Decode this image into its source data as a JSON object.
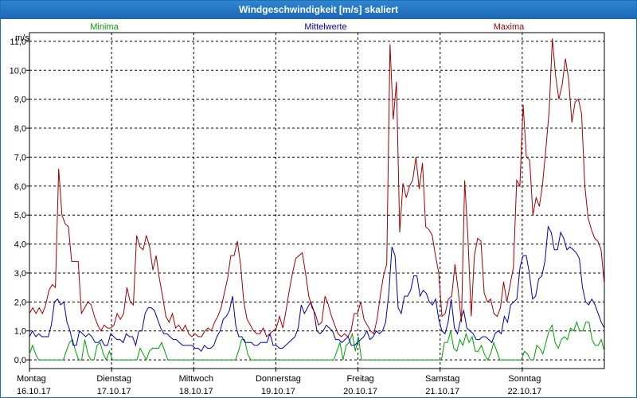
{
  "chart_data": {
    "type": "line",
    "title": "Windgeschwindigkeit [m/s] skaliert",
    "ylabel": "m/s",
    "ylim": [
      -0.3,
      11.3
    ],
    "yticks": [
      "0,0",
      "1,0",
      "2,0",
      "3,0",
      "4,0",
      "5,0",
      "6,0",
      "7,0",
      "8,0",
      "9,0",
      "10,0",
      "11,0"
    ],
    "ytick_values": [
      0,
      1,
      2,
      3,
      4,
      5,
      6,
      7,
      8,
      9,
      10,
      11
    ],
    "xlim": [
      0,
      7
    ],
    "xticks": [
      {
        "day": "Montag",
        "date": "16.10.17"
      },
      {
        "day": "Dienstag",
        "date": "17.10.17"
      },
      {
        "day": "Mittwoch",
        "date": "18.10.17"
      },
      {
        "day": "Donnerstag",
        "date": "19.10.17"
      },
      {
        "day": "Freitag",
        "date": "20.10.17"
      },
      {
        "day": "Samstag",
        "date": "21.10.17"
      },
      {
        "day": "Sonntag",
        "date": "22.10.17"
      }
    ],
    "grid": true,
    "legend_position": "top",
    "series": [
      {
        "name": "Minima",
        "color": "#00a000",
        "values": [
          0.2,
          0.5,
          0.2,
          0.0,
          0.0,
          0.0,
          0.0,
          0.0,
          0.0,
          0.0,
          0.0,
          0.0,
          0.3,
          0.6,
          0.7,
          0.3,
          0.0,
          0.0,
          0.7,
          0.2,
          0.0,
          0.0,
          0.5,
          0.6,
          0.2,
          0.0,
          0.3,
          0.0,
          0.0,
          0.0,
          0.0,
          0.0,
          0.0,
          0.0,
          0.0,
          0.0,
          0.4,
          0.2,
          0.0,
          0.3,
          0.4,
          0.4,
          0.4,
          0.6,
          0.3,
          0.0,
          0.0,
          0.0,
          0.0,
          0.0,
          0.0,
          0.0,
          0.0,
          0.0,
          0.0,
          0.0,
          0.0,
          0.0,
          0.0,
          0.0,
          0.0,
          0.0,
          0.0,
          0.0,
          0.0,
          0.0,
          0.0,
          0.0,
          0.3,
          0.7,
          0.7,
          0.2,
          0.0,
          0.0,
          0.0,
          0.0,
          0.0,
          0.0,
          0.0,
          0.0,
          0.0,
          0.0,
          0.0,
          0.0,
          0.0,
          0.0,
          0.0,
          0.0,
          0.0,
          0.0,
          0.0,
          0.0,
          0.0,
          0.0,
          0.0,
          0.0,
          0.0,
          0.0,
          0.0,
          0.0,
          0.3,
          0.6,
          0.0,
          0.5,
          0.6,
          0.9,
          0.3,
          0.8,
          0.0,
          0.0,
          0.0,
          0.0,
          0.0,
          0.0,
          0.0,
          0.0,
          0.0,
          0.0,
          0.0,
          0.0,
          0.0,
          0.0,
          0.0,
          0.0,
          0.0,
          0.0,
          0.0,
          0.0,
          0.0,
          0.0,
          0.0,
          0.0,
          0.0,
          0.0,
          0.0,
          0.6,
          0.6,
          1.0,
          0.4,
          0.3,
          0.7,
          0.5,
          0.9,
          0.6,
          0.8,
          0.3,
          0.3,
          0.5,
          0.2,
          0.0,
          0.2,
          0.6,
          0.3,
          0.0,
          0.0,
          0.0,
          0.0,
          0.0,
          0.0,
          0.0,
          0.0,
          0.3,
          0.2,
          0.0,
          0.0,
          0.5,
          0.4,
          0.2,
          0.6,
          1.0,
          1.2,
          0.6,
          0.4,
          0.7,
          0.8,
          0.7,
          1.1,
          1.0,
          1.3,
          1.0,
          1.0,
          1.3,
          1.3,
          0.7,
          0.5,
          0.5,
          0.7,
          0.3
        ]
      },
      {
        "name": "Mittelwerte",
        "color": "#0000b0",
        "values": [
          0.8,
          1.0,
          0.8,
          0.9,
          0.8,
          0.8,
          0.8,
          1.2,
          2.0,
          2.1,
          1.9,
          2.0,
          1.3,
          1.0,
          0.5,
          0.5,
          1.0,
          0.9,
          0.8,
          0.9,
          0.8,
          0.6,
          0.6,
          0.7,
          0.5,
          0.5,
          0.9,
          0.8,
          0.7,
          0.7,
          0.6,
          0.9,
          0.8,
          0.8,
          0.5,
          1.0,
          1.0,
          1.6,
          1.8,
          1.8,
          1.7,
          1.4,
          1.1,
          0.9,
          0.9,
          0.8,
          0.7,
          0.7,
          0.6,
          0.5,
          0.5,
          0.5,
          0.5,
          0.4,
          0.4,
          0.3,
          0.5,
          0.4,
          0.4,
          0.5,
          0.8,
          1.0,
          1.4,
          1.5,
          1.7,
          2.2,
          1.2,
          0.8,
          0.8,
          0.6,
          0.6,
          0.6,
          0.5,
          0.5,
          0.6,
          0.6,
          0.6,
          0.9,
          0.5,
          0.5,
          0.4,
          0.4,
          0.5,
          0.6,
          0.7,
          0.8,
          1.1,
          1.9,
          1.6,
          1.8,
          2.0,
          1.7,
          1.0,
          0.9,
          1.0,
          1.2,
          1.1,
          1.0,
          0.7,
          0.7,
          0.6,
          0.7,
          0.8,
          0.5,
          0.5,
          0.6,
          0.7,
          0.8,
          1.0,
          0.7,
          0.8,
          1.0,
          0.9,
          1.0,
          1.3,
          2.3,
          3.9,
          3.6,
          1.8,
          1.6,
          2.2,
          2.2,
          2.4,
          2.9,
          2.9,
          2.2,
          2.4,
          2.3,
          2.0,
          1.9,
          2.1,
          1.4,
          1.0,
          0.9,
          1.3,
          2.1,
          1.1,
          0.9,
          1.4,
          1.7,
          1.1,
          1.0,
          0.9,
          0.7,
          0.7,
          0.8,
          0.8,
          0.7,
          0.6,
          0.9,
          1.0,
          0.9,
          1.5,
          1.3,
          1.9,
          2.0,
          2.1,
          3.2,
          3.6,
          3.6,
          3.0,
          2.1,
          2.2,
          2.8,
          2.9,
          3.4,
          4.6,
          4.4,
          3.8,
          3.8,
          4.4,
          4.2,
          3.8,
          3.9,
          3.8,
          3.7,
          3.5,
          2.5,
          2.0,
          1.9,
          2.1,
          1.9,
          1.6,
          1.3,
          1.1
        ]
      },
      {
        "name": "Maxima",
        "color": "#a00000",
        "values": [
          1.6,
          1.8,
          1.6,
          1.8,
          1.6,
          1.9,
          2.4,
          2.6,
          2.5,
          6.6,
          5.0,
          4.7,
          4.6,
          3.4,
          3.4,
          3.4,
          1.6,
          1.8,
          2.0,
          1.9,
          1.5,
          1.2,
          1.0,
          1.2,
          1.1,
          1.1,
          1.2,
          1.6,
          1.4,
          1.6,
          2.5,
          2.0,
          1.9,
          4.3,
          3.9,
          3.8,
          4.3,
          3.9,
          3.1,
          3.6,
          2.8,
          2.2,
          1.5,
          1.3,
          1.6,
          1.1,
          1.2,
          1.0,
          1.2,
          0.9,
          0.8,
          0.9,
          0.8,
          0.8,
          1.0,
          1.1,
          1.0,
          1.3,
          1.5,
          1.8,
          2.3,
          2.8,
          3.6,
          3.6,
          4.1,
          3.3,
          2.0,
          1.4,
          1.2,
          1.0,
          0.9,
          0.9,
          1.1,
          0.8,
          0.9,
          1.0,
          1.1,
          1.5,
          1.1,
          1.7,
          2.4,
          3.0,
          3.5,
          3.6,
          3.7,
          3.0,
          2.2,
          1.8,
          1.6,
          1.2,
          1.3,
          2.2,
          1.9,
          1.5,
          1.2,
          0.9,
          0.8,
          0.9,
          0.8,
          1.0,
          1.6,
          1.6,
          2.0,
          1.4,
          1.2,
          1.0,
          0.9,
          1.4,
          2.2,
          2.9,
          3.3,
          10.9,
          8.3,
          9.6,
          4.4,
          6.1,
          5.6,
          6.0,
          6.2,
          7.0,
          5.9,
          6.8,
          4.6,
          4.5,
          4.3,
          3.6,
          3.0,
          1.5,
          1.6,
          2.1,
          2.2,
          3.3,
          2.4,
          1.3,
          6.2,
          4.2,
          1.5,
          3.6,
          4.2,
          4.1,
          2.3,
          2.0,
          2.1,
          1.6,
          1.5,
          1.8,
          2.7,
          2.0,
          2.6,
          3.2,
          6.2,
          6.0,
          8.8,
          7.0,
          6.9,
          5.0,
          5.6,
          5.3,
          6.1,
          7.3,
          8.6,
          11.1,
          9.8,
          9.0,
          9.5,
          10.4,
          9.7,
          8.2,
          8.9,
          9.0,
          8.5,
          6.0,
          4.9,
          4.5,
          4.2,
          4.1,
          3.8,
          2.6
        ]
      }
    ]
  }
}
